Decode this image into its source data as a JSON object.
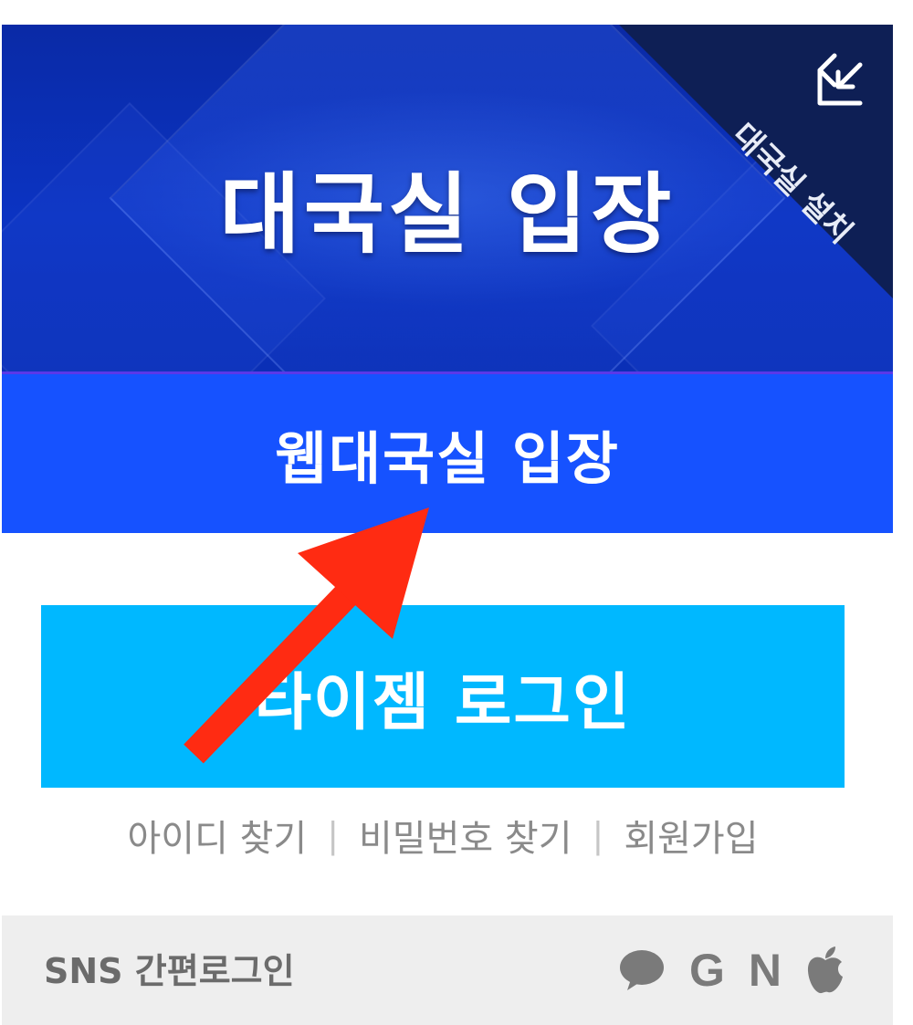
{
  "hero": {
    "title": "대국실 입장",
    "corner_label": "대국실 설치"
  },
  "web_button": {
    "label": "웹대국실 입장"
  },
  "login_button": {
    "label": "타이젬 로그인"
  },
  "links": [
    {
      "label": "아이디 찾기"
    },
    {
      "label": "비밀번호 찾기"
    },
    {
      "label": "회원가입"
    }
  ],
  "separator": "|",
  "sns": {
    "label": "SNS 간편로그인",
    "icons": [
      {
        "name": "kakao-icon"
      },
      {
        "name": "google-icon",
        "text": "G"
      },
      {
        "name": "naver-icon",
        "text": "N"
      },
      {
        "name": "apple-icon"
      }
    ]
  },
  "colors": {
    "hero_bg": "#0b33c2",
    "web_button": "#1652ff",
    "login_button": "#00b8ff",
    "annotation_arrow": "#ff2b12"
  }
}
